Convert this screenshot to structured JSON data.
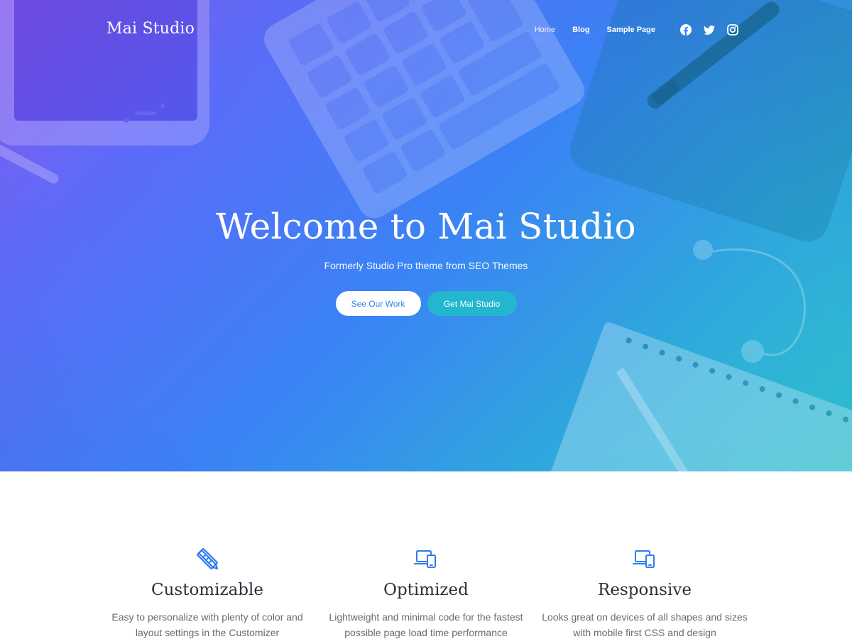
{
  "header": {
    "site_title": "Mai Studio",
    "nav": [
      {
        "label": "Home",
        "active": true
      },
      {
        "label": "Blog",
        "active": false
      },
      {
        "label": "Sample Page",
        "active": false
      }
    ],
    "social": [
      "facebook-icon",
      "twitter-icon",
      "instagram-icon"
    ]
  },
  "hero": {
    "title": "Welcome to Mai Studio",
    "subtitle": "Formerly Studio Pro theme from SEO Themes",
    "primary_button": "See Our Work",
    "secondary_button": "Get Mai Studio",
    "gradient_colors": [
      "#8a5cf6",
      "#3b82f6",
      "#2ec4d0"
    ]
  },
  "features": [
    {
      "icon": "pencil-ruler-icon",
      "title": "Customizable",
      "text_line1": "Easy to personalize with plenty of color and",
      "text_line2": "layout settings in the Customizer"
    },
    {
      "icon": "devices-icon",
      "title": "Optimized",
      "text_line1": "Lightweight and minimal code for the fastest",
      "text_line2": "possible page load time performance"
    },
    {
      "icon": "devices-icon",
      "title": "Responsive",
      "text_line1": "Looks great on devices of all shapes and sizes",
      "text_line2": "with mobile first CSS and design"
    }
  ],
  "colors": {
    "accent": "#2f84f2",
    "teal": "#22b7cf",
    "heading": "#2b2f3a",
    "body_text": "#666a73"
  }
}
